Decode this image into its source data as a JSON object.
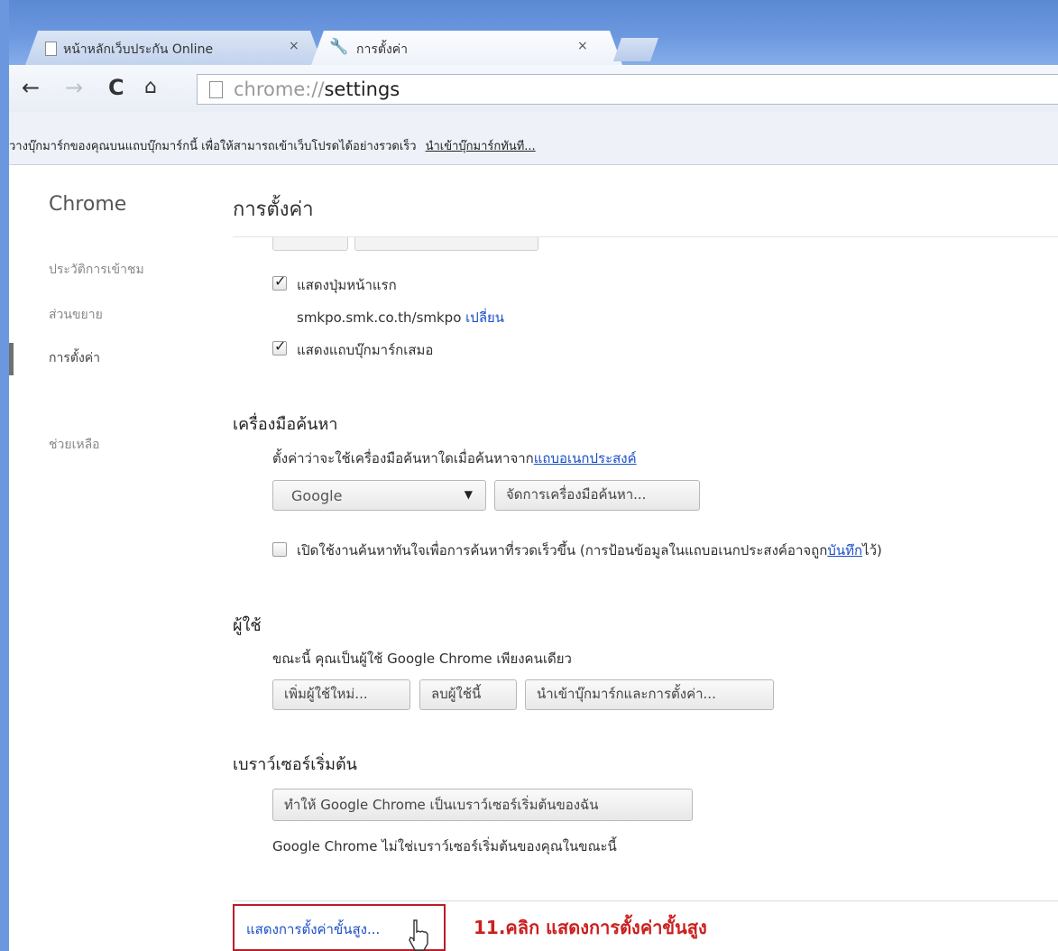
{
  "tabs": [
    {
      "title": "หน้าหลักเว็บประกัน Online",
      "close": "×"
    },
    {
      "title": "การตั้งค่า",
      "close": "×"
    }
  ],
  "toolbar": {
    "url_scheme": "chrome://",
    "url_host": "settings"
  },
  "bookmark_bar": {
    "message": "วางบุ๊กมาร์กของคุณบนแถบบุ๊กมาร์กนี้ เพื่อให้สามารถเข้าเว็บโปรดได้อย่างรวดเร็ว",
    "import_link": "นำเข้าบุ๊กมาร์กทันที..."
  },
  "sidebar": {
    "title": "Chrome",
    "items": [
      {
        "label": "ประวัติการเข้าชม"
      },
      {
        "label": "ส่วนขยาย"
      },
      {
        "label": "การตั้งค่า"
      },
      {
        "label": "ช่วยเหลือ"
      }
    ]
  },
  "settings": {
    "page_title": "การตั้งค่า",
    "appearance": {
      "show_home_button": "แสดงปุ่มหน้าแรก",
      "home_url": "smkpo.smk.co.th/smkpo",
      "change_link": "เปลี่ยน",
      "show_bookmarks_bar": "แสดงแถบบุ๊กมาร์กเสมอ"
    },
    "search": {
      "title": "เครื่องมือค้นหา",
      "description": "ตั้งค่าว่าจะใช้เครื่องมือค้นหาใดเมื่อค้นหาจาก",
      "omnibox_link": "แถบอเนกประสงค์",
      "engine_selected": "Google",
      "manage_button": "จัดการเครื่องมือค้นหา...",
      "instant_label": "เปิดใช้งานค้นหาทันใจเพื่อการค้นหาที่รวดเร็วขึ้น (การป้อนข้อมูลในแถบอเนกประสงค์อาจถูก",
      "instant_link": "บันทึก",
      "instant_suffix": "ไว้)"
    },
    "users": {
      "title": "ผู้ใช้",
      "description": "ขณะนี้ คุณเป็นผู้ใช้ Google Chrome เพียงคนเดียว",
      "add_button": "เพิ่มผู้ใช้ใหม่...",
      "delete_button": "ลบผู้ใช้นี้",
      "import_button": "นำเข้าบุ๊กมาร์กและการตั้งค่า..."
    },
    "default_browser": {
      "title": "เบราว์เซอร์เริ่มต้น",
      "make_default_button": "ทำให้ Google Chrome เป็นเบราว์เซอร์เริ่มต้นของฉัน",
      "status": "Google Chrome ไม่ใช่เบราว์เซอร์เริ่มต้นของคุณในขณะนี้"
    },
    "advanced_link": "แสดงการตั้งค่าขั้นสูง..."
  },
  "annotation": {
    "text": "11.คลิก แสดงการตั้งค่าขั้นสูง",
    "color": "#cc1f1f"
  },
  "colors": {
    "link": "#1a4fc8",
    "highlight_border": "#b81e2a"
  }
}
